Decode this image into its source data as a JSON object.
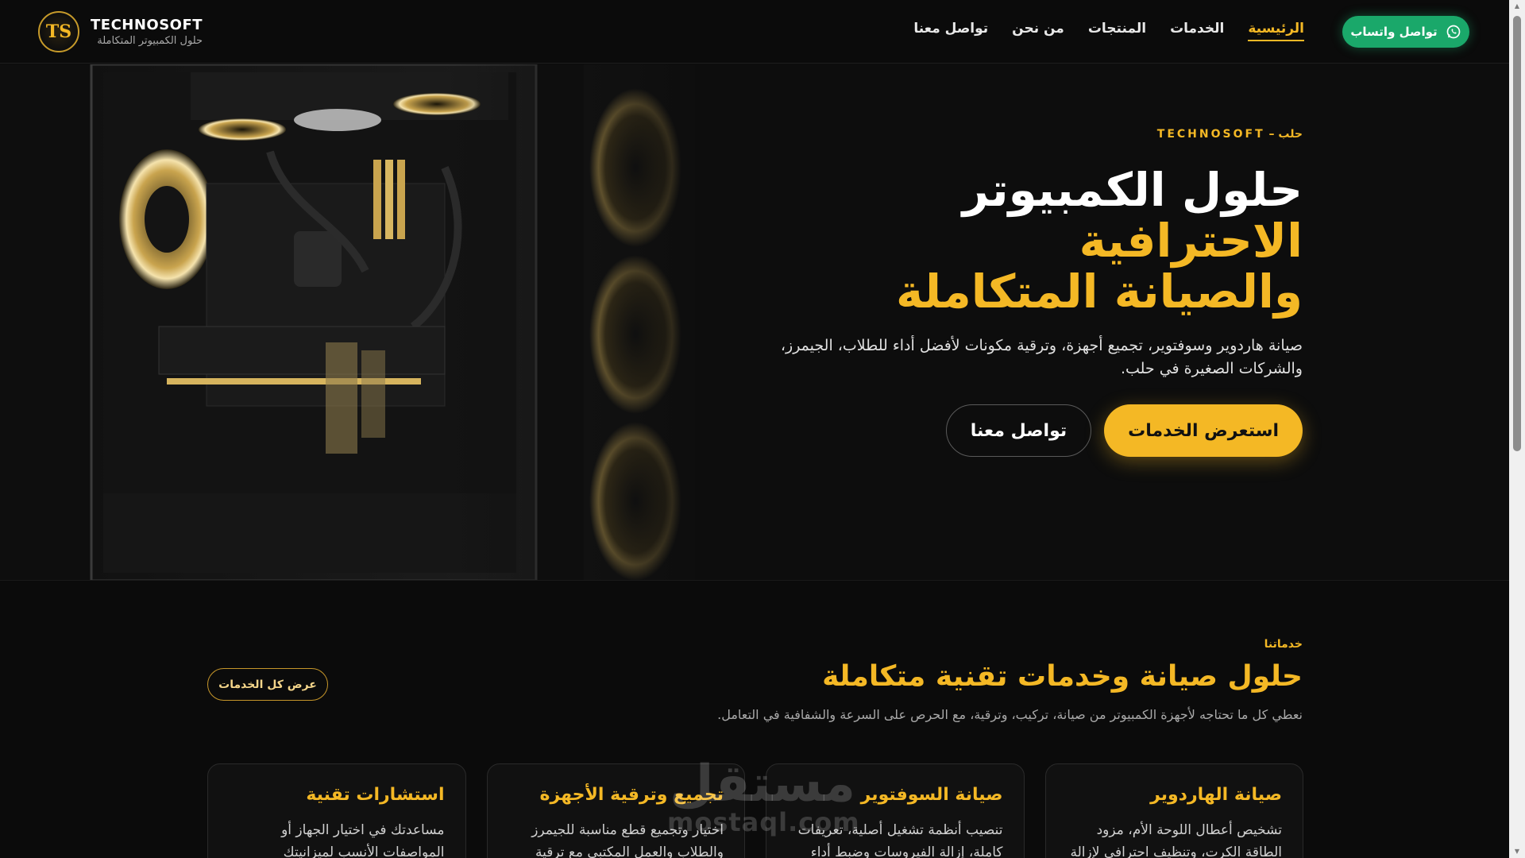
{
  "brand": {
    "logo_letters": "TS",
    "name": "TECHNOSOFT",
    "tagline": "حلول الكمبيوتر المتكاملة"
  },
  "nav": {
    "items": [
      {
        "label": "الرئيسية",
        "active": true
      },
      {
        "label": "الخدمات"
      },
      {
        "label": "المنتجات"
      },
      {
        "label": "من نحن"
      },
      {
        "label": "تواصل معنا"
      }
    ],
    "whatsapp_label": "تواصل واتساب",
    "whatsapp_icon": "whatsapp-icon"
  },
  "hero": {
    "eyebrow": "حلب – TECHNOSOFT",
    "title_white": "حلول الكمبيوتر",
    "title_gold_1": "الاحترافية",
    "title_gold_2": "والصيانة المتكاملة",
    "description": "صيانة هاردوير وسوفتوير، تجميع أجهزة، وترقية مكونات لأفضل أداء للطلاب، الجيمرز، والشركات الصغيرة في حلب.",
    "primary_button": "استعرض الخدمات",
    "secondary_button": "تواصل معنا"
  },
  "services": {
    "eyebrow": "خدماتنا",
    "title": "حلول صيانة وخدمات تقنية متكاملة",
    "subtitle": "نعطي كل ما تحتاجه لأجهزة الكمبيوتر من صيانة، تركيب، وترقية، مع الحرص على السرعة والشفافية في التعامل.",
    "all_button": "عرض كل الخدمات",
    "cards": [
      {
        "title": "صيانة الهاردوير",
        "text": "تشخيص أعطال اللوحة الأم، مزود الطاقة الكرت، وتنظيف احترافي لإزالة"
      },
      {
        "title": "صيانة السوفتوير",
        "text": "تنصيب أنظمة تشغيل أصلية، تعريفات كاملة، إزالة الفيروسات وضبط أداء"
      },
      {
        "title": "تجميع وترقية الأجهزة",
        "text": "اختيار وتجميع قطع مناسبة للجيمرز والطلاب والعمل المكتبي مع ترقية"
      },
      {
        "title": "استشارات تقنية",
        "text": "مساعدتك في اختيار الجهاز أو المواصفات الأنسب لميزانيتك"
      }
    ]
  },
  "watermark": {
    "arabic": "مستقل",
    "latin": "mostaql.com"
  },
  "colors": {
    "accent": "#f4b825",
    "whatsapp": "#1aa86a",
    "background": "#0c0c0c"
  }
}
